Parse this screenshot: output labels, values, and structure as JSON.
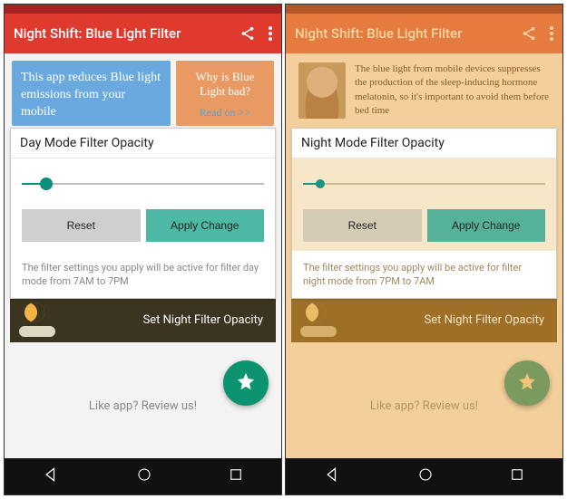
{
  "left": {
    "appbar": {
      "title": "Night Shift: Blue Light Filter"
    },
    "card_blue_text": "This app reduces Blue light emissions from your mobile",
    "card_orange": {
      "heading": "Why is Blue Light bad?",
      "readon": "Read on >>"
    },
    "panel": {
      "title": "Day Mode Filter Opacity",
      "reset_label": "Reset",
      "apply_label": "Apply Change",
      "hint": "The filter settings you apply will be active for filter day mode from 7AM to 7PM"
    },
    "night_banner": "Set Night Filter Opacity",
    "review": "Like app? Review us!"
  },
  "right": {
    "appbar": {
      "title": "Night Shift: Blue Light Filter"
    },
    "info_text": "The blue light from mobile devices suppresses the production of the sleep-inducing hormone melatonin, so it's important to avoid them before bed time",
    "panel": {
      "title": "Night Mode Filter Opacity",
      "reset_label": "Reset",
      "apply_label": "Apply Change",
      "hint": "The filter settings you apply will be active for filter night mode from 7PM to 7AM"
    },
    "night_banner": "Set Night Filter Opacity",
    "review": "Like app? Review us!"
  }
}
